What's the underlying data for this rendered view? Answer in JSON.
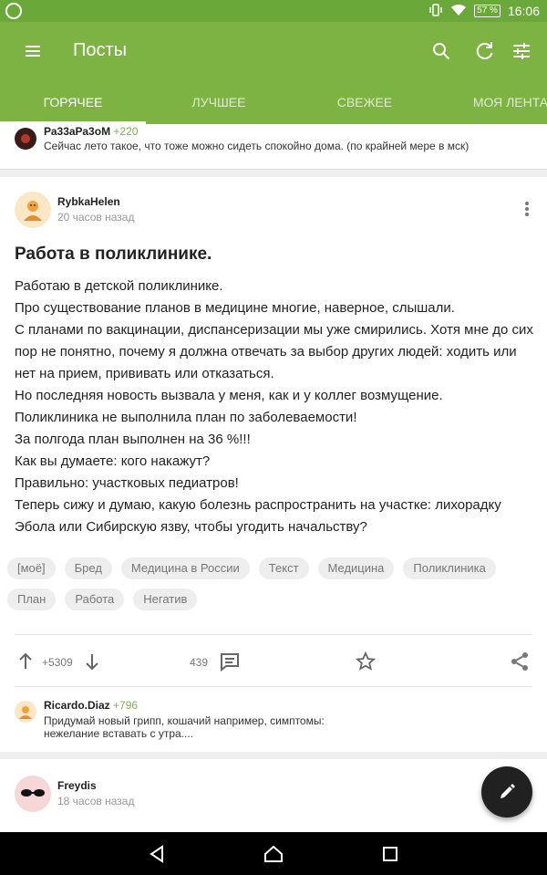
{
  "status": {
    "battery": "57 %",
    "time": "16:06"
  },
  "appbar": {
    "title": "Посты"
  },
  "tabs": [
    {
      "label": "Горячее"
    },
    {
      "label": "Лучшее"
    },
    {
      "label": "Свежее"
    },
    {
      "label": "Моя лента"
    }
  ],
  "top_comment": {
    "author": "Ра33аРа3оМ",
    "score": "+220",
    "text": "Сейчас лето такое, что тоже можно сидеть спокойно дома. (по крайней мере в мск)"
  },
  "post": {
    "author": "RybkaHelen",
    "time": "20 часов назад",
    "title": "Работа в поликлинике.",
    "body": [
      "Работаю в детской поликлинике.",
      "Про существование планов в медицине многие, наверное, слышали.",
      "С планами по вакцинации, диспансеризации мы уже смирились. Хотя мне до сих пор не понятно, почему я должна отвечать за выбор других людей: ходить или нет на прием, прививать или отказаться.",
      "Но последняя новость вызвала у меня, как и у коллег возмущение.",
      "Поликлиника не выполнила план по заболеваемости!",
      "За полгода план выполнен на 36 %!!!",
      "Как вы думаете: кого накажут?",
      "Правильно: участковых педиатров!",
      "Теперь сижу и думаю, какую болезнь распространить на участке: лихорадку Эбола или Сибирскую язву, чтобы угодить начальству?"
    ],
    "tags": [
      "[моё]",
      "Бред",
      "Медицина в России",
      "Текст",
      "Медицина",
      "Поликлиника",
      "План",
      "Работа",
      "Негатив"
    ],
    "rating": "+5309",
    "comments_count": "439"
  },
  "preview_comment": {
    "author": "Ricardo.Diaz",
    "score": "+796",
    "text_line1": "Придумай новый грипп, кошачий например, симптомы:",
    "text_line2": "нежелание вставать с утра...."
  },
  "next_post": {
    "author": "Freydis",
    "time": "18 часов назад"
  },
  "colors": {
    "primary": "#7cb342",
    "status": "#6aa839",
    "accent_score": "#7cb342"
  }
}
